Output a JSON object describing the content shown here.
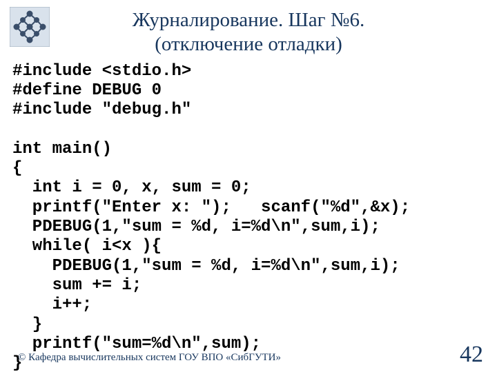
{
  "title_line1": "Журналирование. Шаг №6.",
  "title_line2": "(отключение отладки)",
  "code": "#include <stdio.h>\n#define DEBUG 0\n#include \"debug.h\"\n\nint main()\n{\n  int i = 0, x, sum = 0;\n  printf(\"Enter x: \");   scanf(\"%d\",&x);\n  PDEBUG(1,\"sum = %d, i=%d\\n\",sum,i);\n  while( i<x ){\n    PDEBUG(1,\"sum = %d, i=%d\\n\",sum,i);\n    sum += i;\n    i++;\n  }\n  printf(\"sum=%d\\n\",sum);\n}",
  "footer": "© Кафедра вычислительных систем ГОУ ВПО «СибГУТИ»",
  "pagenum": "42"
}
